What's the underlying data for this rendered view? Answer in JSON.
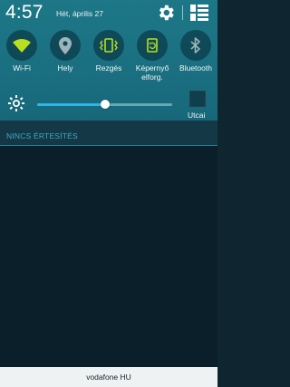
{
  "status": {
    "time": "4:57",
    "date": "Hét, április 27"
  },
  "icons": {
    "settings": "gear-icon",
    "quick_settings_grid": "grid-icon"
  },
  "quick_toggles": [
    {
      "label": "Wi-Fi",
      "icon": "wifi-icon",
      "active": true
    },
    {
      "label": "Hely",
      "icon": "location-icon",
      "active": false
    },
    {
      "label": "Rezgés",
      "icon": "vibrate-icon",
      "active": true
    },
    {
      "label": "Képernyő\nelforg.",
      "icon": "screen-rotation-icon",
      "active": true
    },
    {
      "label": "Bluetooth",
      "icon": "bluetooth-icon",
      "active": false
    }
  ],
  "brightness": {
    "icon": "brightness-icon",
    "level_fraction": 0.5,
    "auto_label": "Utcai",
    "auto_checked": false
  },
  "notifications": {
    "header": "NINCS ÉRTESÍTÉS"
  },
  "carrier": "vodafone HU",
  "colors": {
    "panel_bg": "#1d7787",
    "toggle_active": "#b8e01e",
    "toggle_inactive": "#9fb4ba",
    "slider_fill": "#2fb5e8",
    "notif_header_text": "#3fa9c9"
  }
}
